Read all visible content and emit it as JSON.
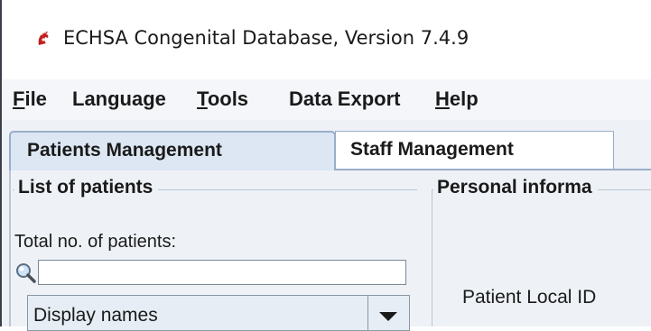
{
  "window": {
    "title": "ECHSA Congenital Database, Version 7.4.9",
    "icon": "echsa-app-icon"
  },
  "menu": {
    "items": [
      {
        "mnemonic": "F",
        "rest": "ile"
      },
      {
        "mnemonic": "",
        "rest": "Language"
      },
      {
        "mnemonic": "T",
        "rest": "ools"
      },
      {
        "mnemonic": "",
        "rest": "Data Export"
      },
      {
        "mnemonic": "H",
        "rest": "elp"
      }
    ]
  },
  "tabs": [
    {
      "label": "Patients Management",
      "selected": true
    },
    {
      "label": "Staff Management",
      "selected": false
    }
  ],
  "patients_list": {
    "title": "List of patients",
    "total_label": "Total no. of patients:",
    "search_value": "",
    "search_icon": "magnifier-icon",
    "display_select_value": "Display names"
  },
  "personal_info": {
    "title": "Personal informa",
    "patient_local_id_label": "Patient Local ID"
  },
  "colors": {
    "menubar_bg": "#f4f6f9",
    "content_bg": "#eef2f6",
    "active_tab_bg": "#dce7f3",
    "border": "#9aaec8"
  }
}
